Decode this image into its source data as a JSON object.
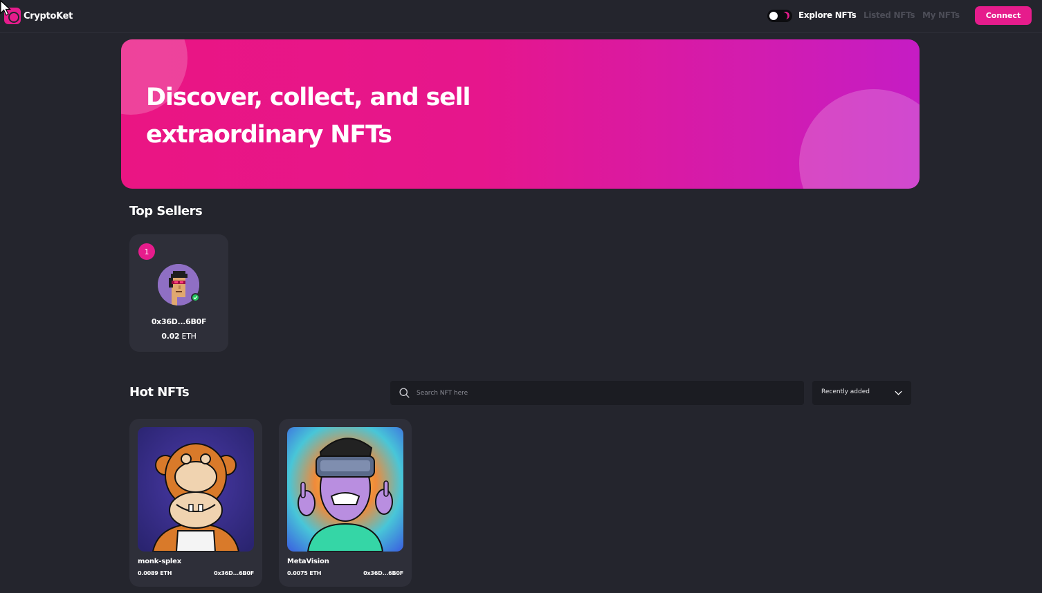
{
  "navbar": {
    "logo_text": "CryptoKet",
    "links": [
      {
        "label": "Explore NFTs",
        "active": true
      },
      {
        "label": "Listed NFTs",
        "active": false
      },
      {
        "label": "My NFTs",
        "active": false
      }
    ],
    "connect_label": "Connect"
  },
  "hero": {
    "title": "Discover, collect, and sell extraordinary NFTs"
  },
  "top_sellers": {
    "title": "Top Sellers",
    "sellers": [
      {
        "rank": "1",
        "address": "0x36D...6B0F",
        "amount": "0.02",
        "currency": "ETH"
      }
    ]
  },
  "hot_nfts": {
    "title": "Hot NFTs",
    "search_placeholder": "Search NFT here",
    "sort_value": "Recently added",
    "items": [
      {
        "name": "monk-splex",
        "price": "0.0089 ETH",
        "owner": "0x36D...6B0F"
      },
      {
        "name": "MetaVision",
        "price": "0.0075 ETH",
        "owner": "0x36D...6B0F"
      }
    ]
  },
  "colors": {
    "background": "#24252d",
    "card": "#2e2f39",
    "accent": "#e61c8c",
    "muted_link": "#4c4d57"
  },
  "icons": {
    "search": "search-icon",
    "dropdown": "chevron-down-icon",
    "verified": "check-icon",
    "theme": "moon-icon",
    "cursor": "cursor-icon"
  }
}
